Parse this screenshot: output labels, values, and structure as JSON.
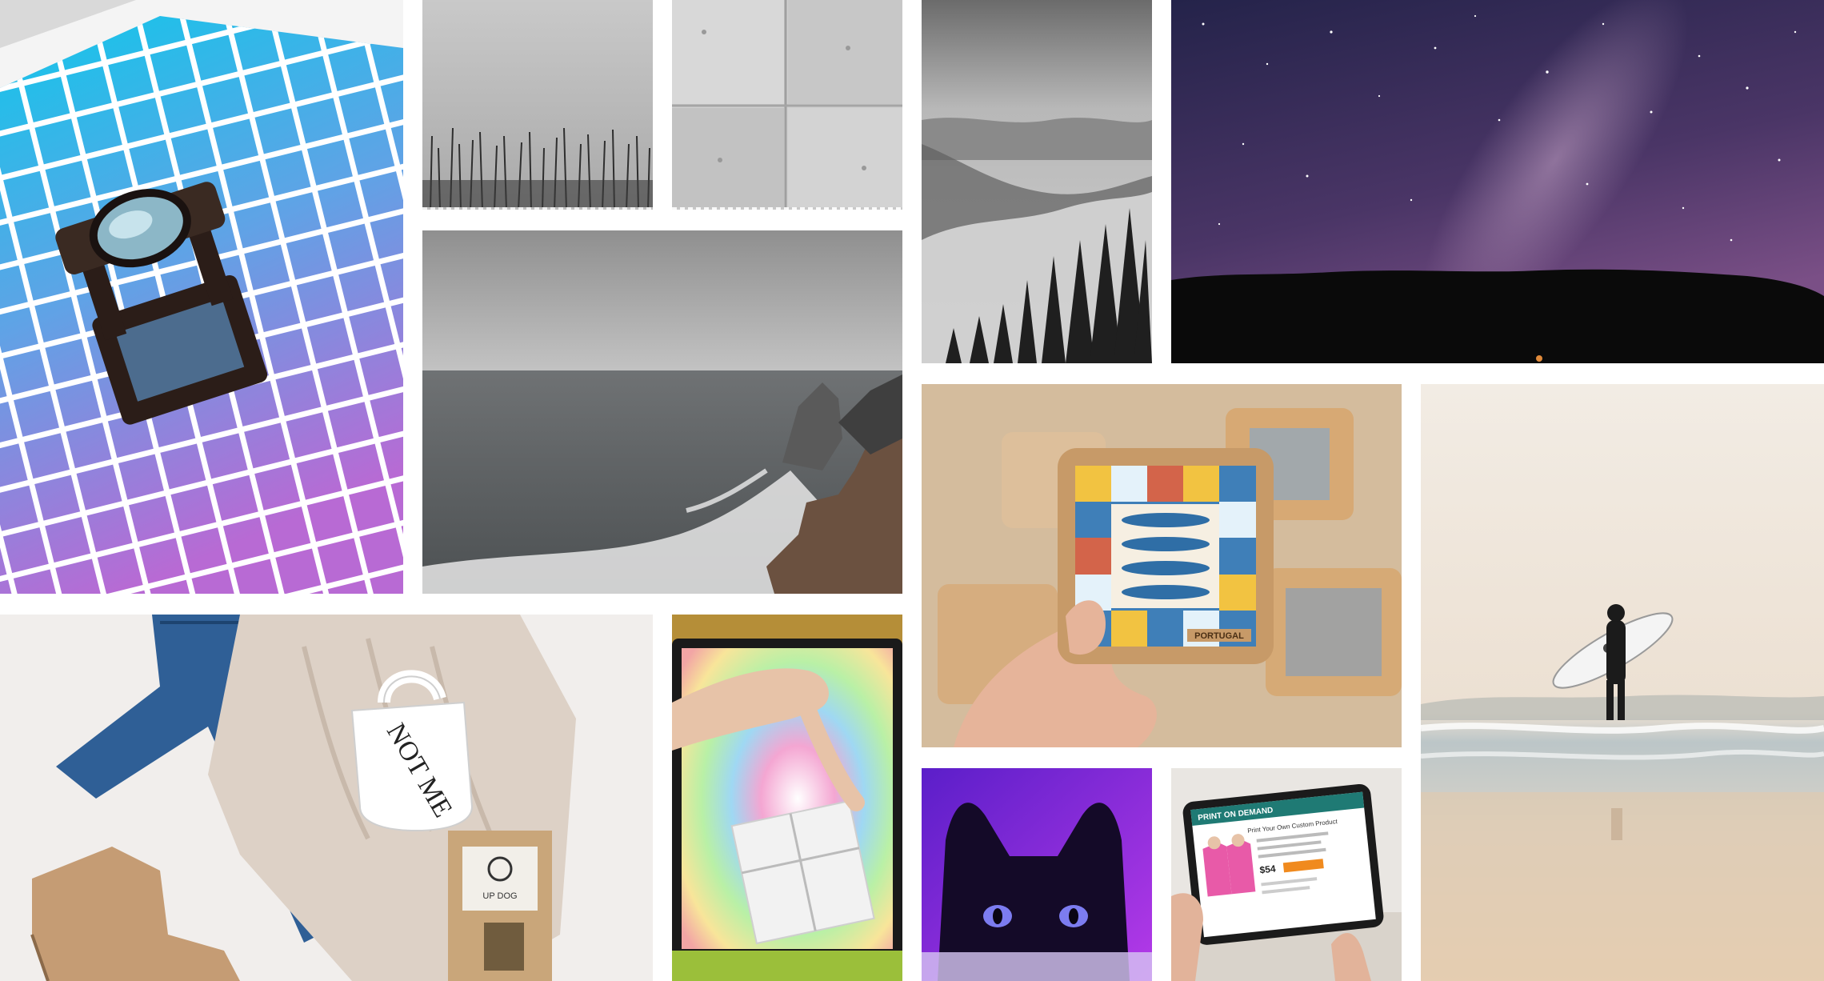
{
  "gallery": {
    "tiles": [
      {
        "name": "color-swatch-loupe",
        "subject": "magnifying loupe on cyan-to-violet color swatch grid"
      },
      {
        "name": "misty-reeds",
        "subject": "grey sky over silhouetted reeds"
      },
      {
        "name": "concrete-wall",
        "subject": "grey concrete wall panels"
      },
      {
        "name": "foggy-forest",
        "subject": "black and white foggy pine forest hills"
      },
      {
        "name": "milky-way",
        "subject": "starry purple night sky over tree line"
      },
      {
        "name": "rocky-coast",
        "subject": "grey sea crashing on rocky coastline"
      },
      {
        "name": "tile-coaster",
        "subject": "hand holding cork coaster with patterned tiles and fish"
      },
      {
        "name": "surfer-beach",
        "subject": "surfer holding board at the shore"
      },
      {
        "name": "flat-lay-clothes",
        "subject": "jeans, knit sweater, mug, tea bag and ankle boots"
      },
      {
        "name": "package-screen",
        "subject": "hand holding wrapped parcel in front of rainbow screen"
      },
      {
        "name": "purple-cat",
        "subject": "black cat peeking with purple lighting"
      },
      {
        "name": "pod-tablet",
        "subject": "tablet showing print on demand store with pink hoodies"
      }
    ],
    "mug_text": "NOT ME",
    "tea_label": "UP DOG",
    "coaster_banner": "PORTUGAL",
    "tablet": {
      "header": "PRINT ON DEMAND",
      "headline": "Print Your Own Custom Product",
      "price": "$54"
    }
  },
  "colors": {
    "background": "#ffffff",
    "swatch_cyan": "#19c4e6",
    "swatch_violet": "#b36bd6",
    "night_sky": "#3b2a5c",
    "cat_purple": "#7a2be0",
    "tablet_teal": "#1f7a74",
    "hoodie_pink": "#e85aa8"
  }
}
